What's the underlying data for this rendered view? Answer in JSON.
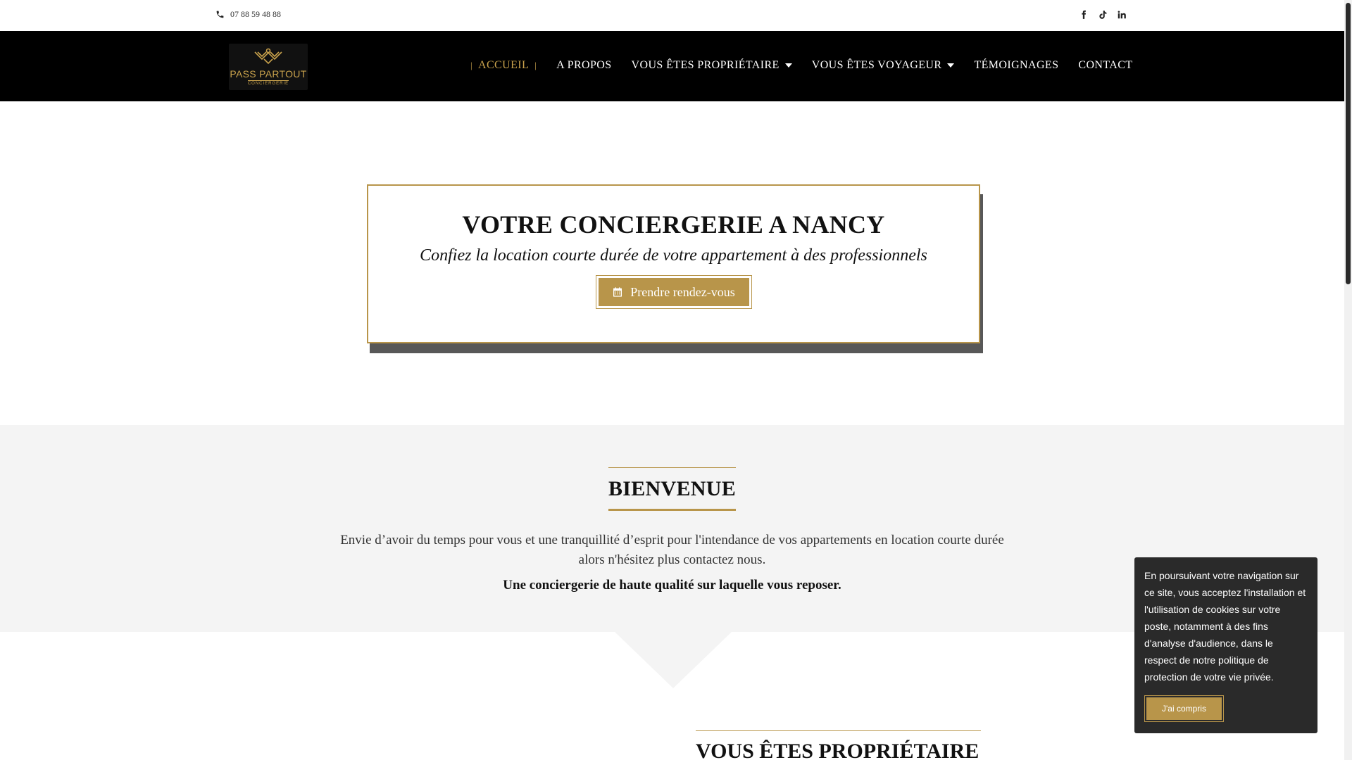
{
  "topbar": {
    "phone": "07 88 59 48 88",
    "social_icons": [
      "facebook-icon",
      "tiktok-icon",
      "linkedin-icon"
    ]
  },
  "logo": {
    "name": "PASS PARTOUT",
    "sub": "CONCIERGERIE"
  },
  "nav": {
    "separator": "|",
    "items": [
      {
        "label": "ACCUEIL",
        "active": true
      },
      {
        "label": "A PROPOS"
      },
      {
        "label": "VOUS ÊTES PROPRIÉTAIRE",
        "dropdown": true
      },
      {
        "label": "VOUS ÊTES VOYAGEUR",
        "dropdown": true
      },
      {
        "label": "TÉMOIGNAGES"
      },
      {
        "label": "CONTACT"
      }
    ]
  },
  "hero": {
    "title": "VOTRE CONCIERGERIE A NANCY",
    "subtitle": "Confiez la location courte durée de votre appartement à des professionnels",
    "button_label": "Prendre rendez-vous"
  },
  "welcome": {
    "title": "BIENVENUE",
    "text": "Envie d’avoir du temps pour vous et une tranquillité d’esprit pour l'intendance de vos appartements en location courte durée alors n'hésitez plus contactez nous.",
    "tagline": "Une conciergerie de haute qualité sur laquelle vous reposer."
  },
  "owner_section": {
    "title": "VOUS ÊTES PROPRIÉTAIRE"
  },
  "cookie_banner": {
    "text": "En poursuivant votre navigation sur ce site, vous acceptez l'installation et l'utilisation de cookies sur votre poste, notamment à des fins d'analyse d'audience, dans le respect de notre politique de protection de votre vie privée.",
    "button_label": "J'ai compris"
  },
  "colors": {
    "accent": "#b8954a",
    "nav_bg": "#000000",
    "section_bg": "#f4f4f4",
    "cookie_bg": "#2a2a2a"
  }
}
